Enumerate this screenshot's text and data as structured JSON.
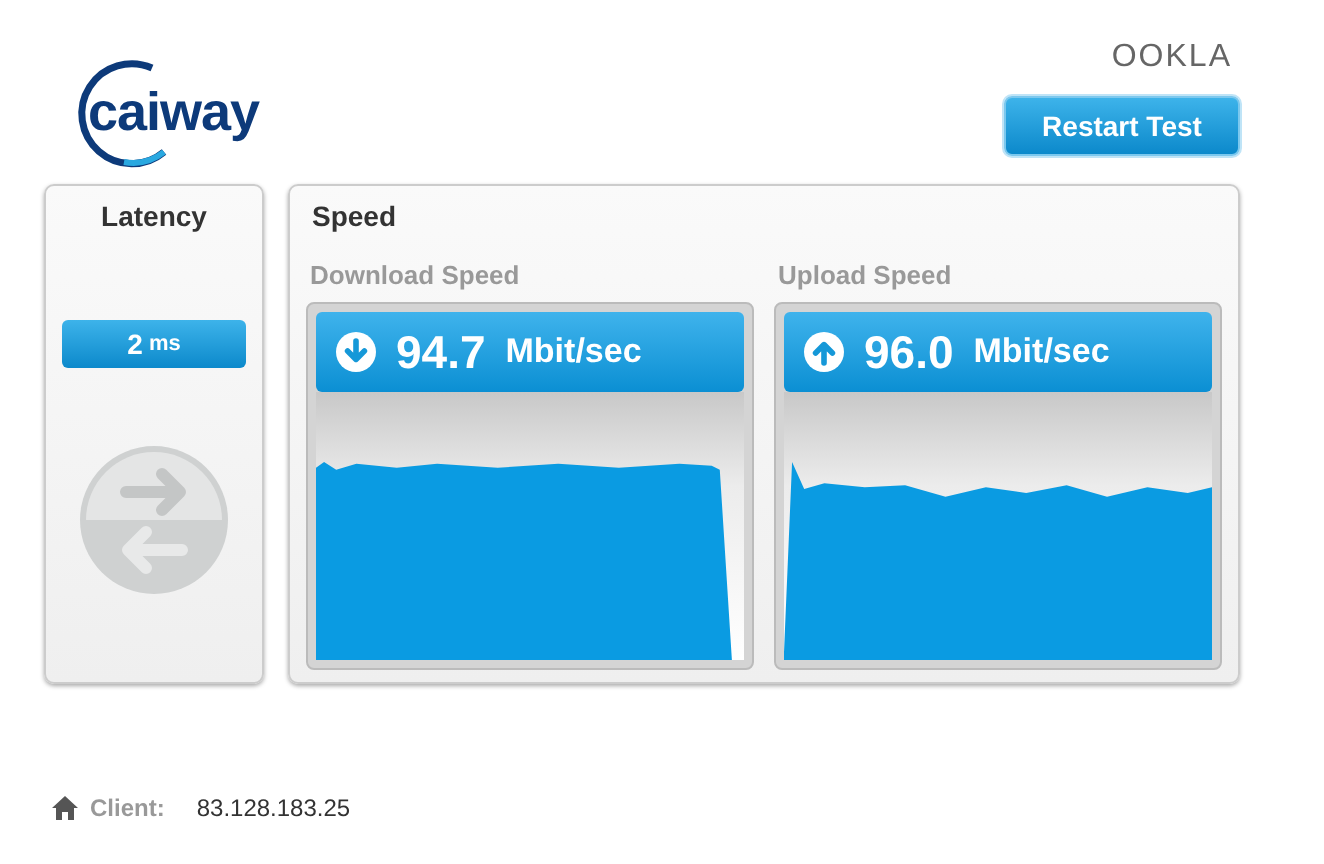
{
  "header": {
    "logo": "caiway",
    "brand": "OOKLA",
    "restart_button": "Restart Test"
  },
  "latency": {
    "title": "Latency",
    "value": "2",
    "unit": "ms"
  },
  "speed": {
    "title": "Speed",
    "tests": [
      {
        "kind": "download",
        "label": "Download Speed",
        "value": "94.7",
        "unit": "Mbit/sec"
      },
      {
        "kind": "upload",
        "label": "Upload Speed",
        "value": "96.0",
        "unit": "Mbit/sec"
      }
    ]
  },
  "client": {
    "label": "Client:",
    "ip": "83.128.183.25"
  }
}
